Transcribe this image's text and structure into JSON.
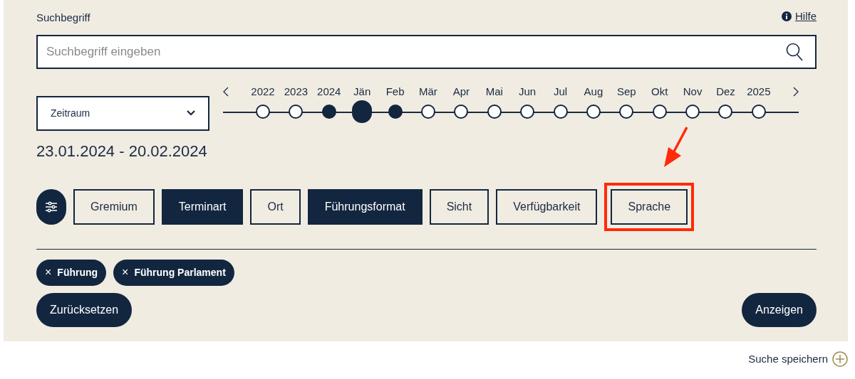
{
  "search": {
    "label": "Suchbegriff",
    "help": "Hilfe",
    "placeholder": "Suchbegriff eingeben"
  },
  "period": {
    "select": "Zeitraum",
    "range": "23.01.2024 - 20.02.2024"
  },
  "timeline": [
    {
      "label": "2022",
      "in_range": false,
      "selected": false
    },
    {
      "label": "2023",
      "in_range": false,
      "selected": false
    },
    {
      "label": "2024",
      "in_range": true,
      "selected": false
    },
    {
      "label": "Jän",
      "in_range": true,
      "selected": true
    },
    {
      "label": "Feb",
      "in_range": true,
      "selected": false
    },
    {
      "label": "Mär",
      "in_range": false,
      "selected": false
    },
    {
      "label": "Apr",
      "in_range": false,
      "selected": false
    },
    {
      "label": "Mai",
      "in_range": false,
      "selected": false
    },
    {
      "label": "Jun",
      "in_range": false,
      "selected": false
    },
    {
      "label": "Jul",
      "in_range": false,
      "selected": false
    },
    {
      "label": "Aug",
      "in_range": false,
      "selected": false
    },
    {
      "label": "Sep",
      "in_range": false,
      "selected": false
    },
    {
      "label": "Okt",
      "in_range": false,
      "selected": false
    },
    {
      "label": "Nov",
      "in_range": false,
      "selected": false
    },
    {
      "label": "Dez",
      "in_range": false,
      "selected": false
    },
    {
      "label": "2025",
      "in_range": false,
      "selected": false
    }
  ],
  "filters": [
    {
      "label": "Gremium",
      "active": false,
      "highlighted": false
    },
    {
      "label": "Terminart",
      "active": true,
      "highlighted": false
    },
    {
      "label": "Ort",
      "active": false,
      "highlighted": false
    },
    {
      "label": "Führungsformat",
      "active": true,
      "highlighted": false
    },
    {
      "label": "Sicht",
      "active": false,
      "highlighted": false
    },
    {
      "label": "Verfügbarkeit",
      "active": false,
      "highlighted": false
    },
    {
      "label": "Sprache",
      "active": false,
      "highlighted": true
    }
  ],
  "chips": [
    {
      "label": "Führung",
      "remove": "×"
    },
    {
      "label": "Führung Parlament",
      "remove": "×"
    }
  ],
  "reset": "Zurücksetzen",
  "submit": "Anzeigen",
  "save": "Suche speichern"
}
